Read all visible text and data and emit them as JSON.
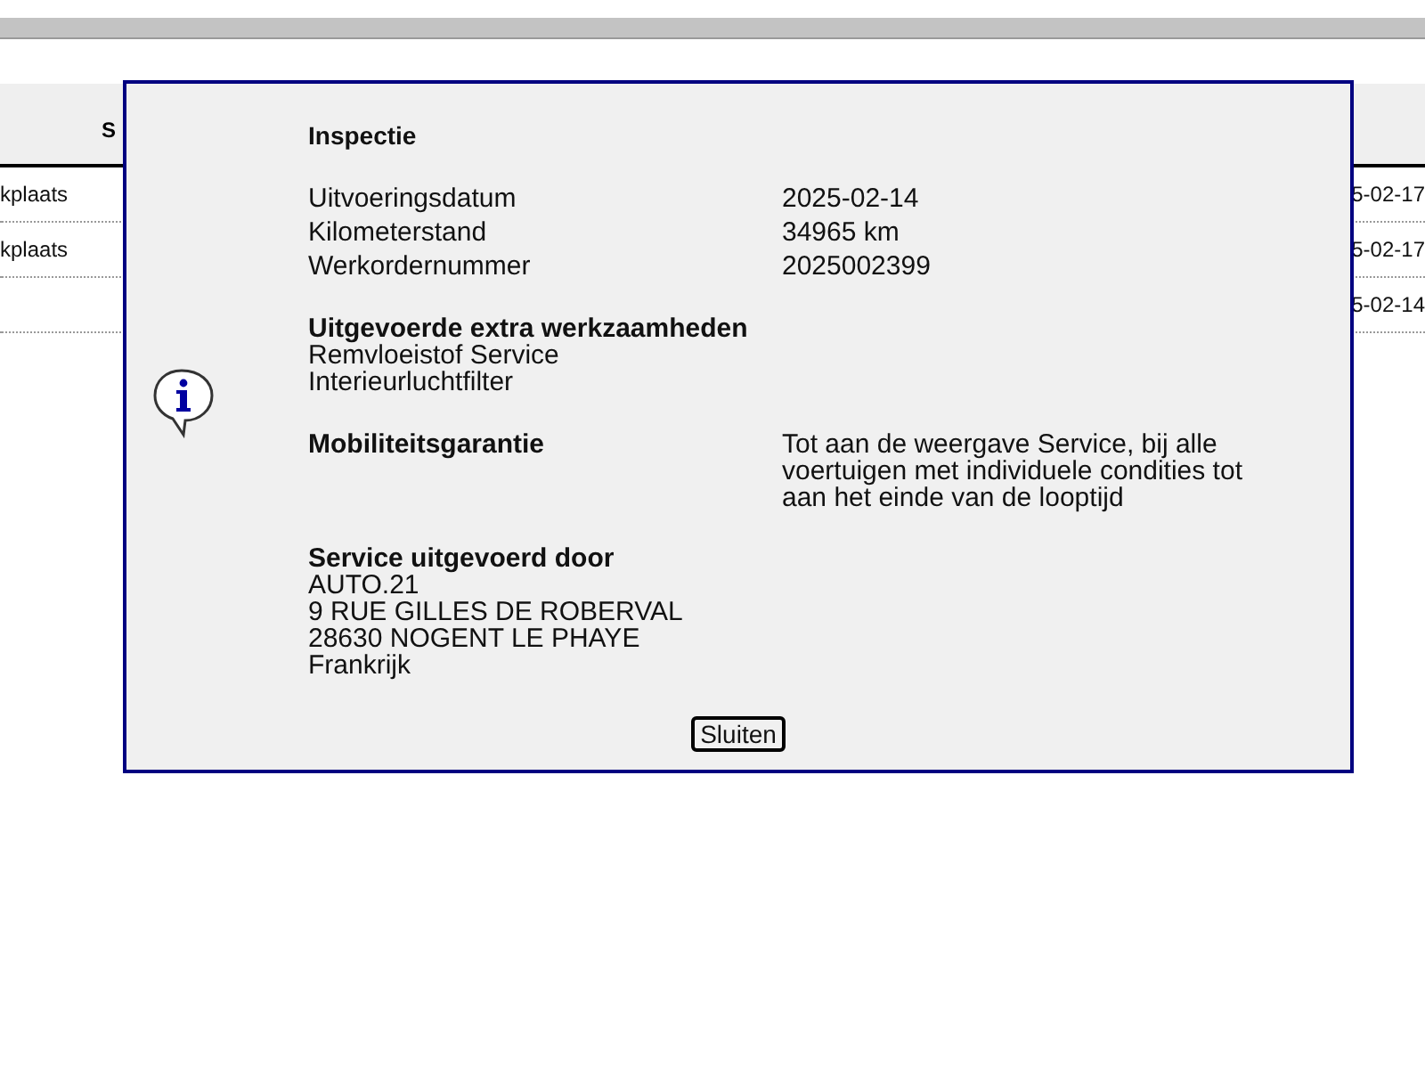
{
  "table": {
    "columns": [
      "S"
    ],
    "rows": [
      {
        "column_1": "kplaats",
        "column_2": "5-02-17"
      },
      {
        "column_1": "kplaats",
        "column_2": "5-02-17"
      },
      {
        "column_2": "5-02-14"
      }
    ]
  },
  "dialog": {
    "title": "Inspectie",
    "fields": [
      {
        "label": "Uitvoeringsdatum",
        "value": "2025-02-14"
      },
      {
        "label": "Kilometerstand",
        "value": "34965 km"
      },
      {
        "label": "Werkordernummer",
        "value": "2025002399"
      }
    ],
    "extra_work": {
      "heading": "Uitgevoerde extra werkzaamheden",
      "items": [
        "Remvloeistof Service",
        "Interieurluchtfilter"
      ]
    },
    "mobility": {
      "label": "Mobiliteitsgarantie",
      "value": "Tot aan de weergave Service, bij alle voertuigen met individuele condities tot aan het einde van de looptijd"
    },
    "performed_by": {
      "heading": "Service uitgevoerd door",
      "lines": [
        "AUTO.21",
        "9 RUE GILLES DE ROBERVAL",
        "28630 NOGENT LE PHAYE",
        "Frankrijk"
      ]
    },
    "button": "Sluiten"
  }
}
